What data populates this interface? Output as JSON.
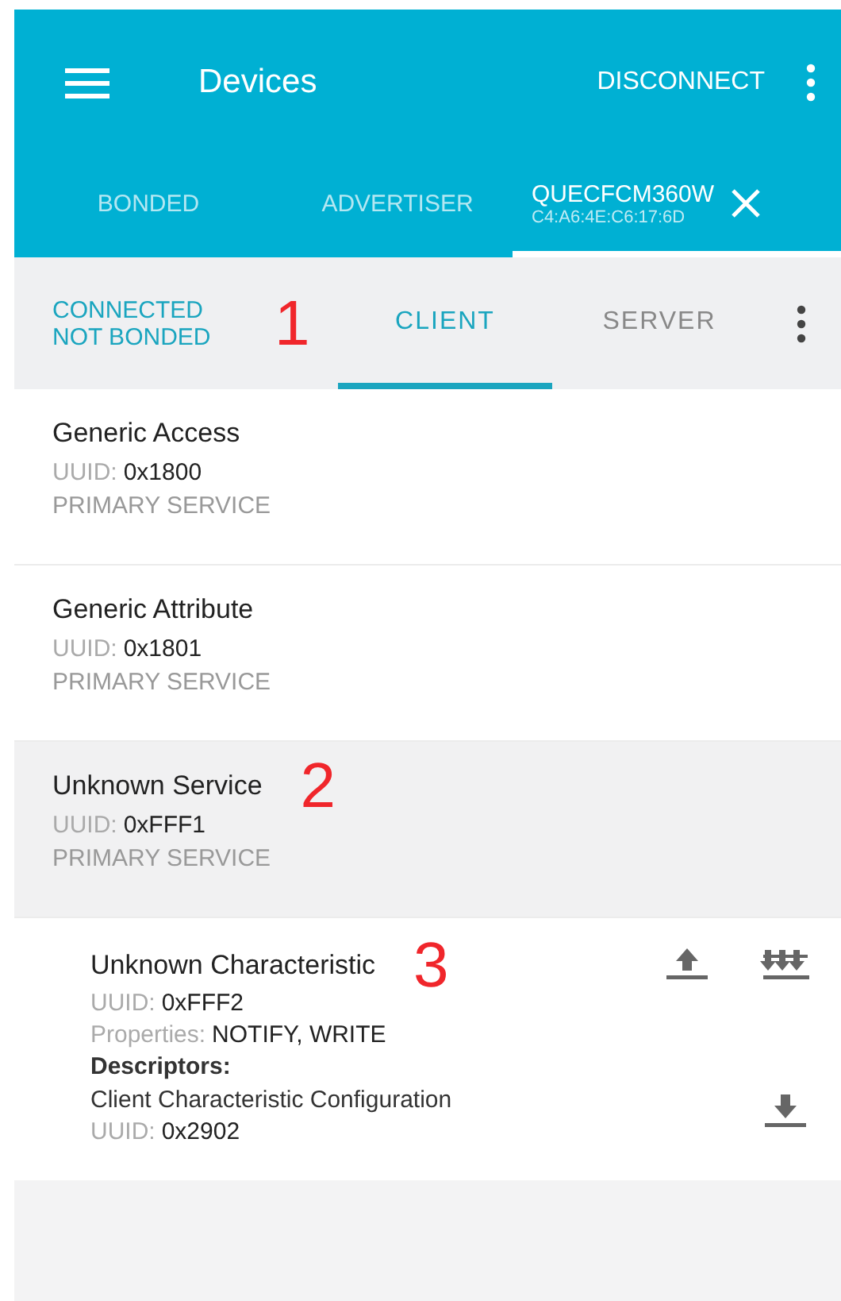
{
  "toolbar": {
    "title": "Devices",
    "action": "DISCONNECT"
  },
  "device_tabs": [
    {
      "label": "BONDED",
      "selected": false
    },
    {
      "label": "ADVERTISER",
      "selected": false
    },
    {
      "label": "QUECFCM360W",
      "subtitle": "C4:A6:4E:C6:17:6D",
      "selected": true
    }
  ],
  "connection": {
    "status": "CONNECTED",
    "bond": "NOT BONDED",
    "marker": "1"
  },
  "view_tabs": [
    {
      "label": "CLIENT",
      "selected": true
    },
    {
      "label": "SERVER",
      "selected": false
    }
  ],
  "services": [
    {
      "name": "Generic Access",
      "uuid_label": "UUID:",
      "uuid": "0x1800",
      "type": "PRIMARY SERVICE",
      "expanded": false
    },
    {
      "name": "Generic Attribute",
      "uuid_label": "UUID:",
      "uuid": "0x1801",
      "type": "PRIMARY SERVICE",
      "expanded": false
    },
    {
      "name": "Unknown Service",
      "uuid_label": "UUID:",
      "uuid": "0xFFF1",
      "type": "PRIMARY SERVICE",
      "expanded": true,
      "marker": "2",
      "characteristics": [
        {
          "name": "Unknown Characteristic",
          "marker": "3",
          "uuid_label": "UUID:",
          "uuid": "0xFFF2",
          "properties_label": "Properties:",
          "properties": "NOTIFY, WRITE",
          "descriptors_label": "Descriptors:",
          "descriptors": [
            {
              "name": "Client Characteristic Configuration",
              "uuid_label": "UUID:",
              "uuid": "0x2902"
            }
          ]
        }
      ]
    }
  ]
}
